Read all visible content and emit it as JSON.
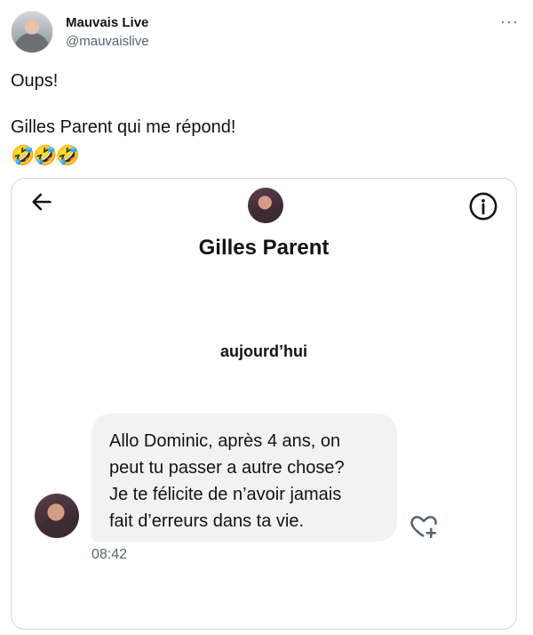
{
  "author": {
    "display_name": "Mauvais Live",
    "handle": "@mauvaislive",
    "more_label": "···"
  },
  "tweet": {
    "lines": [
      "Oups!",
      "",
      "Gilles Parent qui me répond!"
    ],
    "emoji": "🤣🤣🤣"
  },
  "dm": {
    "contact_name": "Gilles Parent",
    "date_label": "aujourd’hui",
    "message_lines": [
      "Allo Dominic, après 4 ans, on",
      "peut tu passer a autre chose?",
      "Je te félicite de n’avoir jamais",
      "fait d’erreurs dans ta vie."
    ],
    "time": "08:42",
    "icons": [
      "back-arrow-icon",
      "info-icon",
      "heart-plus-icon"
    ]
  }
}
